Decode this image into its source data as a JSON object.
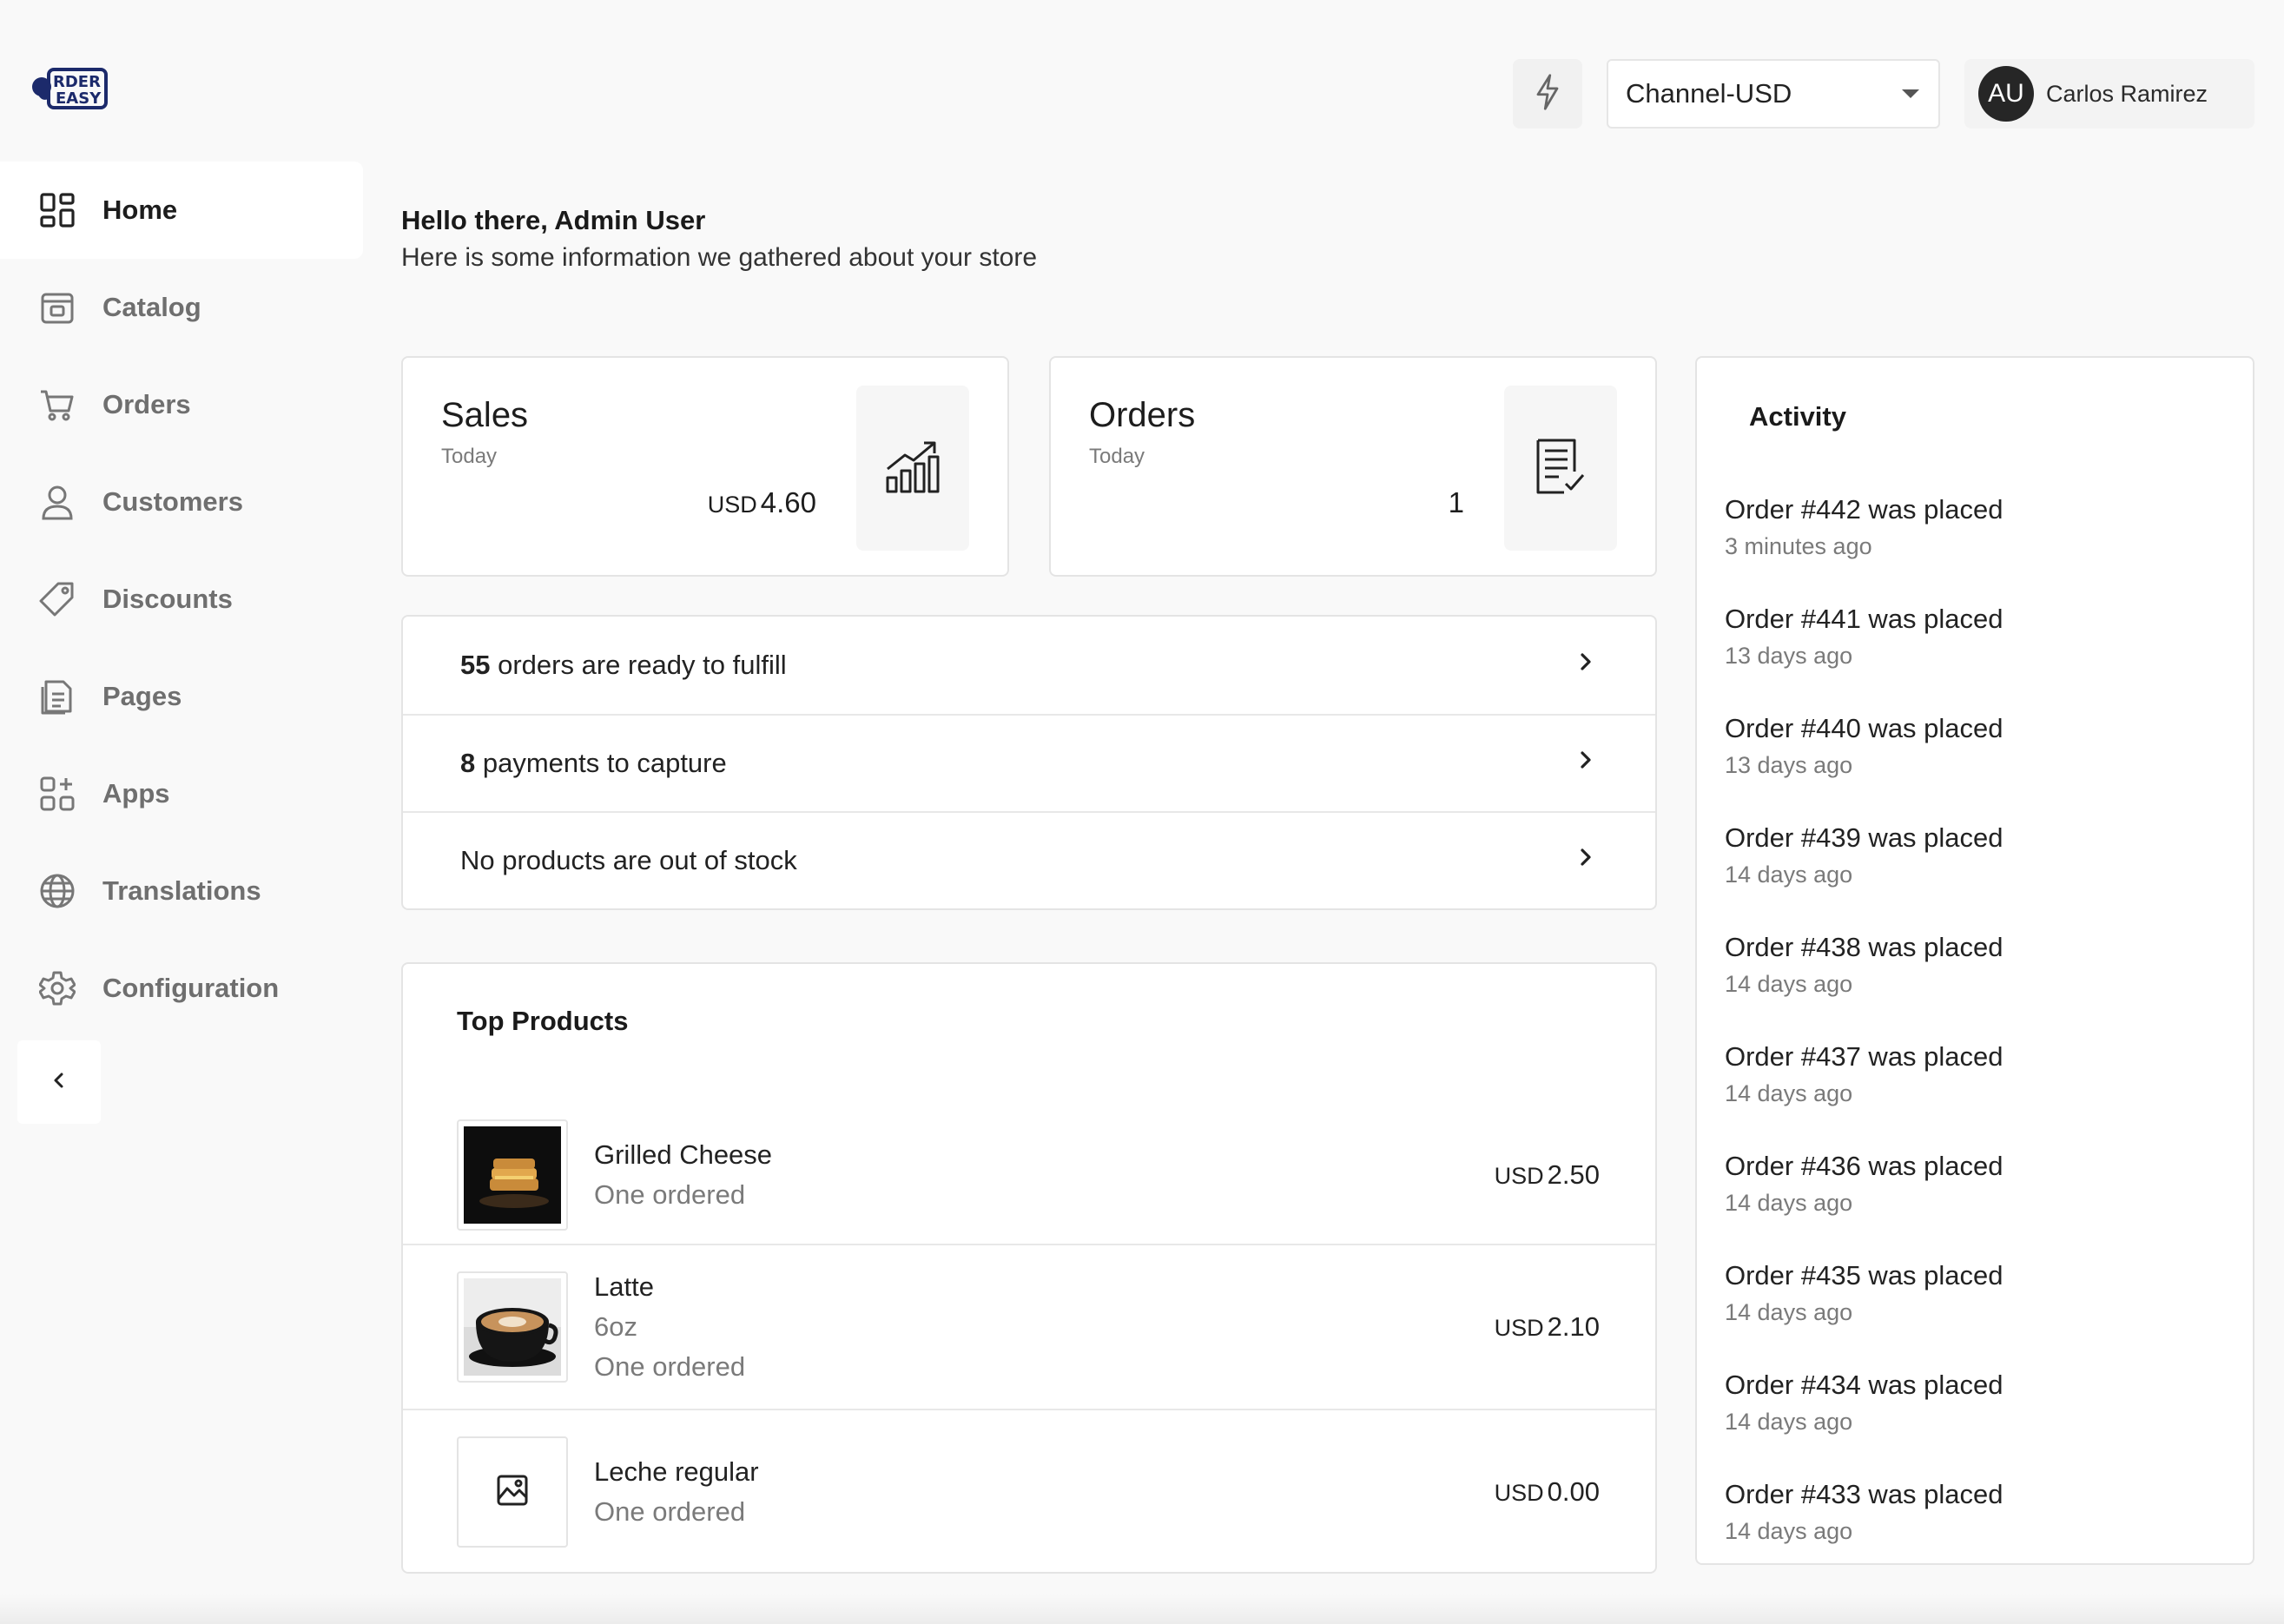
{
  "brand": {
    "logo_text": "ORDER EASY"
  },
  "header": {
    "channel": "Channel-USD",
    "user": {
      "initials": "AU",
      "name": "Carlos Ramirez"
    }
  },
  "sidebar": {
    "items": [
      {
        "label": "Home",
        "icon": "home-grid-icon",
        "active": true
      },
      {
        "label": "Catalog",
        "icon": "catalog-icon"
      },
      {
        "label": "Orders",
        "icon": "cart-icon"
      },
      {
        "label": "Customers",
        "icon": "user-icon"
      },
      {
        "label": "Discounts",
        "icon": "tag-icon"
      },
      {
        "label": "Pages",
        "icon": "pages-icon"
      },
      {
        "label": "Apps",
        "icon": "apps-icon"
      },
      {
        "label": "Translations",
        "icon": "globe-icon"
      },
      {
        "label": "Configuration",
        "icon": "gear-icon"
      }
    ]
  },
  "greeting": {
    "title": "Hello there, Admin User",
    "subtitle": "Here is some information we gathered about your store"
  },
  "stats": {
    "sales": {
      "title": "Sales",
      "period": "Today",
      "currency": "USD",
      "value": "4.60"
    },
    "orders": {
      "title": "Orders",
      "period": "Today",
      "value": "1"
    }
  },
  "notifications": [
    {
      "count": "55",
      "text": " orders are ready to fulfill"
    },
    {
      "count": "8",
      "text": " payments to capture"
    },
    {
      "count": "",
      "text": "No products are out of stock"
    }
  ],
  "top_products": {
    "title": "Top Products",
    "items": [
      {
        "name": "Grilled Cheese",
        "variant": "",
        "ordered": "One ordered",
        "currency": "USD",
        "price": "2.50",
        "image": "grilled-cheese"
      },
      {
        "name": "Latte",
        "variant": "6oz",
        "ordered": "One ordered",
        "currency": "USD",
        "price": "2.10",
        "image": "latte"
      },
      {
        "name": "Leche regular",
        "variant": "",
        "ordered": "One ordered",
        "currency": "USD",
        "price": "0.00",
        "image": "placeholder"
      }
    ]
  },
  "activity": {
    "title": "Activity",
    "items": [
      {
        "text": "Order #442 was placed",
        "time": "3 minutes ago"
      },
      {
        "text": "Order #441 was placed",
        "time": "13 days ago"
      },
      {
        "text": "Order #440 was placed",
        "time": "13 days ago"
      },
      {
        "text": "Order #439 was placed",
        "time": "14 days ago"
      },
      {
        "text": "Order #438 was placed",
        "time": "14 days ago"
      },
      {
        "text": "Order #437 was placed",
        "time": "14 days ago"
      },
      {
        "text": "Order #436 was placed",
        "time": "14 days ago"
      },
      {
        "text": "Order #435 was placed",
        "time": "14 days ago"
      },
      {
        "text": "Order #434 was placed",
        "time": "14 days ago"
      },
      {
        "text": "Order #433 was placed",
        "time": "14 days ago"
      }
    ]
  }
}
